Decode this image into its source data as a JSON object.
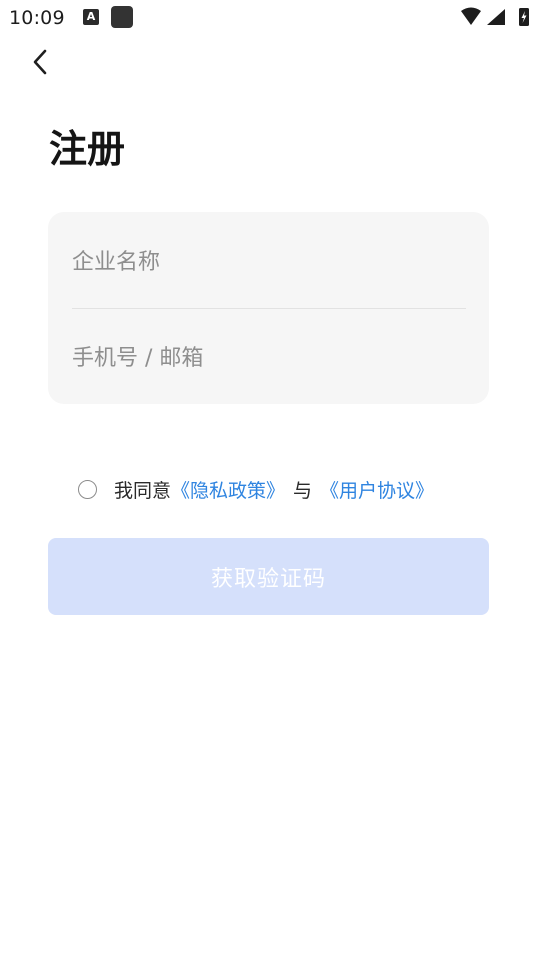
{
  "status_bar": {
    "time": "10:09",
    "notification_a": "A"
  },
  "header": {
    "title": "注册"
  },
  "form": {
    "company_placeholder": "企业名称",
    "company_value": "",
    "phone_placeholder": "手机号 / 邮箱",
    "phone_value": ""
  },
  "agreement": {
    "prefix": "我同意",
    "privacy_link": "《隐私政策》",
    "conjunction": "与",
    "user_agreement_link": "《用户协议》"
  },
  "actions": {
    "submit_label": "获取验证码"
  },
  "colors": {
    "link": "#2f84e0",
    "button_disabled_bg": "#d5e0fb",
    "input_card_bg": "#f6f6f6"
  }
}
